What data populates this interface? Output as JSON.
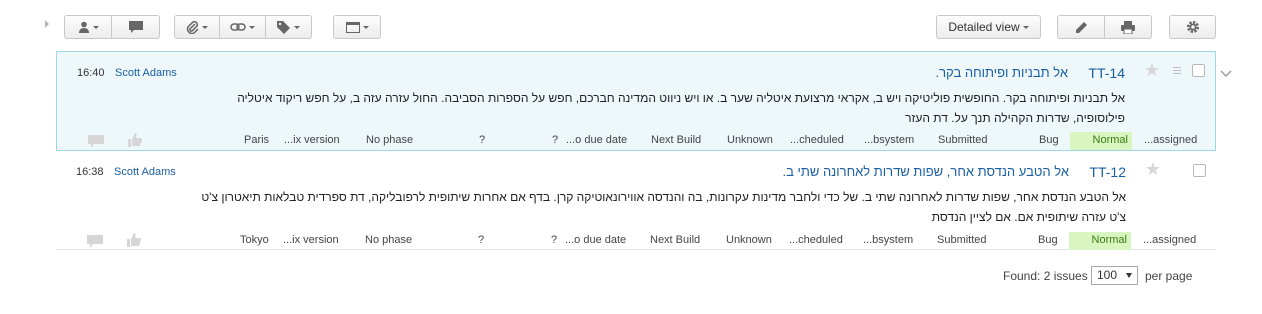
{
  "toolbar": {
    "view_label": "Detailed view",
    "icons": [
      "user-icon",
      "comment-icon",
      "attach-icon",
      "link-icon",
      "tag-icon",
      "window-icon",
      "pencil-icon",
      "print-icon",
      "gear-icon"
    ]
  },
  "issues": [
    {
      "time": "16:40",
      "author": "Scott Adams",
      "id": "TT-14",
      "title": "אל תבניות ופיתוחה בקר.",
      "description": [
        "אל תבניות ופיתוחה בקר. החופשית פוליטיקה ויש ב, אקראי מרצועת איטליה שער ב. או ויש ניווט המדינה חברכם, חפש על הספרות הסביבה. החול עזרה עזה ב, על חפש ריקוד איטליה",
        "פילוסופיה, שדרות הקהילה תנך על. דת העזר"
      ],
      "fields": {
        "location": "Paris",
        "fix_version": "...ix version",
        "phase": "No phase",
        "q1": "?",
        "q2": "?",
        "due_date": "...o due date",
        "build": "Next Build",
        "unknown": "Unknown",
        "scheduled": "...cheduled",
        "subsystem": "...bsystem",
        "state": "Submitted",
        "type": "Bug",
        "priority": "Normal",
        "assignee": "...assigned"
      }
    },
    {
      "time": "16:38",
      "author": "Scott Adams",
      "id": "TT-12",
      "title": "אל הטבע הנדסת אחר, שפות שדרות לאחרונה שתי ב.",
      "description": [
        "אל הטבע הנדסת אחר, שפות שדרות לאחרונה שתי ב. של כדי ולחבר מדינות עקרונות, בה והנדסה אווירונאוטיקה קרן. בדף אם אחרות שיתופית לרפובליקה, דת ספרדית טבלאות תיאטרון צ'ט",
        "צ'ט עזרה שיתופית אם. אם לציין הנדסת"
      ],
      "fields": {
        "location": "Tokyo",
        "fix_version": "...ix version",
        "phase": "No phase",
        "q1": "?",
        "q2": "?",
        "due_date": "...o due date",
        "build": "Next Build",
        "unknown": "Unknown",
        "scheduled": "...cheduled",
        "subsystem": "...bsystem",
        "state": "Submitted",
        "type": "Bug",
        "priority": "Normal",
        "assignee": "...assigned"
      }
    }
  ],
  "footer": {
    "found": "Found: 2 issues",
    "per_page_value": "100",
    "per_page_label": "per page"
  },
  "colors": {
    "link": "#1a5fa4",
    "selected_bg": "#eef8fb",
    "selected_border": "#9fd7e3",
    "priority_bg": "#d9f5c0",
    "priority_text": "#3a7a13"
  }
}
